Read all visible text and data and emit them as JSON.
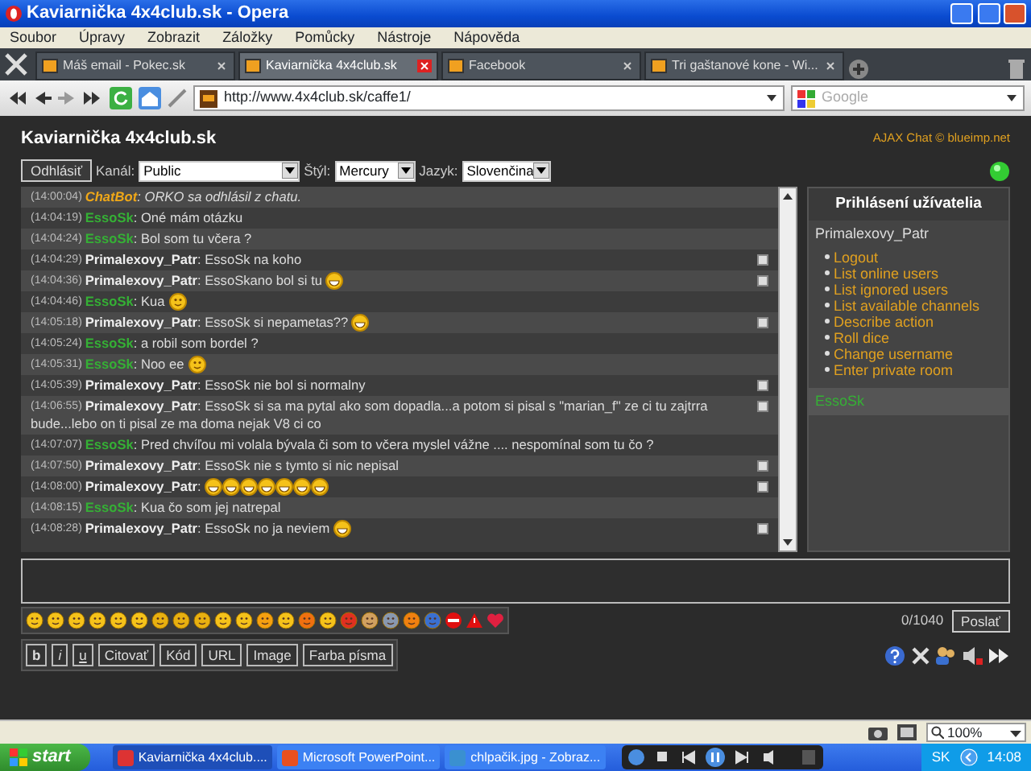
{
  "window": {
    "title": "Kaviarnička 4x4club.sk - Opera"
  },
  "menu": [
    "Soubor",
    "Úpravy",
    "Zobrazit",
    "Záložky",
    "Pomůcky",
    "Nástroje",
    "Nápověda"
  ],
  "tabs": [
    {
      "title": "Máš email - Pokec.sk",
      "selected": false
    },
    {
      "title": "Kaviarnička 4x4club.sk",
      "selected": true
    },
    {
      "title": "Facebook",
      "selected": false
    },
    {
      "title": "Tri gaštanové kone - Wi...",
      "selected": false
    }
  ],
  "address": {
    "url": "http://www.4x4club.sk/caffe1/",
    "search_placeholder": "Google"
  },
  "chat": {
    "title": "Kaviarnička 4x4club.sk",
    "credit": "AJAX Chat © blueimp.net",
    "logout": "Odhlásiť",
    "channel": {
      "label": "Kanál:",
      "value": "Public"
    },
    "style": {
      "label": "Štýl:",
      "value": "Mercury"
    },
    "language": {
      "label": "Jazyk:",
      "value": "Slovenčina"
    },
    "online": true,
    "messages": [
      {
        "time": "(14:00:04)",
        "author": "ChatBot",
        "kind": "bot",
        "text": ": ORKO sa odhlásil z chatu.",
        "deletable": false
      },
      {
        "time": "(14:04:19)",
        "author": "EssoSk",
        "kind": "user",
        "text": ": Oné mám otázku",
        "deletable": false
      },
      {
        "time": "(14:04:24)",
        "author": "EssoSk",
        "kind": "user",
        "text": ": Bol som tu včera ?",
        "deletable": false
      },
      {
        "time": "(14:04:29)",
        "author": "Primalexovy_Patr",
        "kind": "self",
        "text": ": EssoSk na koho",
        "deletable": true
      },
      {
        "time": "(14:04:36)",
        "author": "Primalexovy_Patr",
        "kind": "self",
        "text": ": EssoSkano bol si tu",
        "emoticons": [
          {
            "kind": "grin"
          }
        ],
        "deletable": true
      },
      {
        "time": "(14:04:46)",
        "author": "EssoSk",
        "kind": "user",
        "text": ": Kua",
        "emoticons": [
          {
            "kind": "smile"
          }
        ],
        "deletable": false
      },
      {
        "time": "(14:05:18)",
        "author": "Primalexovy_Patr",
        "kind": "self",
        "text": ": EssoSk si nepametas??",
        "emoticons": [
          {
            "kind": "grin"
          }
        ],
        "deletable": true
      },
      {
        "time": "(14:05:24)",
        "author": "EssoSk",
        "kind": "user",
        "text": ": a robil som bordel ?",
        "deletable": false
      },
      {
        "time": "(14:05:31)",
        "author": "EssoSk",
        "kind": "user",
        "text": ": Noo ee",
        "emoticons": [
          {
            "kind": "smile"
          }
        ],
        "deletable": false
      },
      {
        "time": "(14:05:39)",
        "author": "Primalexovy_Patr",
        "kind": "self",
        "text": ": EssoSk nie bol si normalny",
        "deletable": true
      },
      {
        "time": "(14:06:55)",
        "author": "Primalexovy_Patr",
        "kind": "self",
        "text": ": EssoSk si sa ma pytal ako som dopadla...a potom si pisal s \"marian_f\" ze ci tu zajtrra bude...lebo on ti pisal ze ma doma nejak V8 ci co",
        "deletable": true
      },
      {
        "time": "(14:07:07)",
        "author": "EssoSk",
        "kind": "user",
        "text": ": Pred chvíľou mi volala bývala či som to včera myslel vážne .... nespomínal som tu čo ?",
        "deletable": false
      },
      {
        "time": "(14:07:50)",
        "author": "Primalexovy_Patr",
        "kind": "self",
        "text": ": EssoSk nie s tymto si nic nepisal",
        "deletable": true
      },
      {
        "time": "(14:08:00)",
        "author": "Primalexovy_Patr",
        "kind": "self",
        "text": ":",
        "emoticons": [
          {
            "kind": "grin"
          },
          {
            "kind": "grin"
          },
          {
            "kind": "grin"
          },
          {
            "kind": "grin"
          },
          {
            "kind": "grin"
          },
          {
            "kind": "grin"
          },
          {
            "kind": "grin"
          }
        ],
        "deletable": true
      },
      {
        "time": "(14:08:15)",
        "author": "EssoSk",
        "kind": "user",
        "text": ": Kua čo som jej natrepal",
        "deletable": false
      },
      {
        "time": "(14:08:28)",
        "author": "Primalexovy_Patr",
        "kind": "self",
        "text": ": EssoSk no ja neviem",
        "emoticons": [
          {
            "kind": "grin"
          }
        ],
        "deletable": true
      }
    ],
    "sidebar": {
      "title": "Prihlásení užívatelia",
      "user": "Primalexovy_Patr",
      "commands": [
        "Logout",
        "List online users",
        "List ignored users",
        "List available channels",
        "Describe action",
        "Roll dice",
        "Change username",
        "Enter private room"
      ],
      "online_users": [
        "EssoSk"
      ]
    },
    "counter": "0/1040",
    "send": "Poslať",
    "bbcode": [
      "b",
      "i",
      "u",
      "Citovať",
      "Kód",
      "URL",
      "Image",
      "Farba písma"
    ]
  },
  "status_bar": {
    "zoom": "100%"
  },
  "taskbar": {
    "start": "start",
    "tasks": [
      {
        "title": "Kaviarnička 4x4club....",
        "selected": true
      },
      {
        "title": "Microsoft PowerPoint...",
        "selected": false
      },
      {
        "title": "chlpačik.jpg - Zobraz...",
        "selected": false
      }
    ],
    "language": "SK",
    "clock": "14:08"
  }
}
